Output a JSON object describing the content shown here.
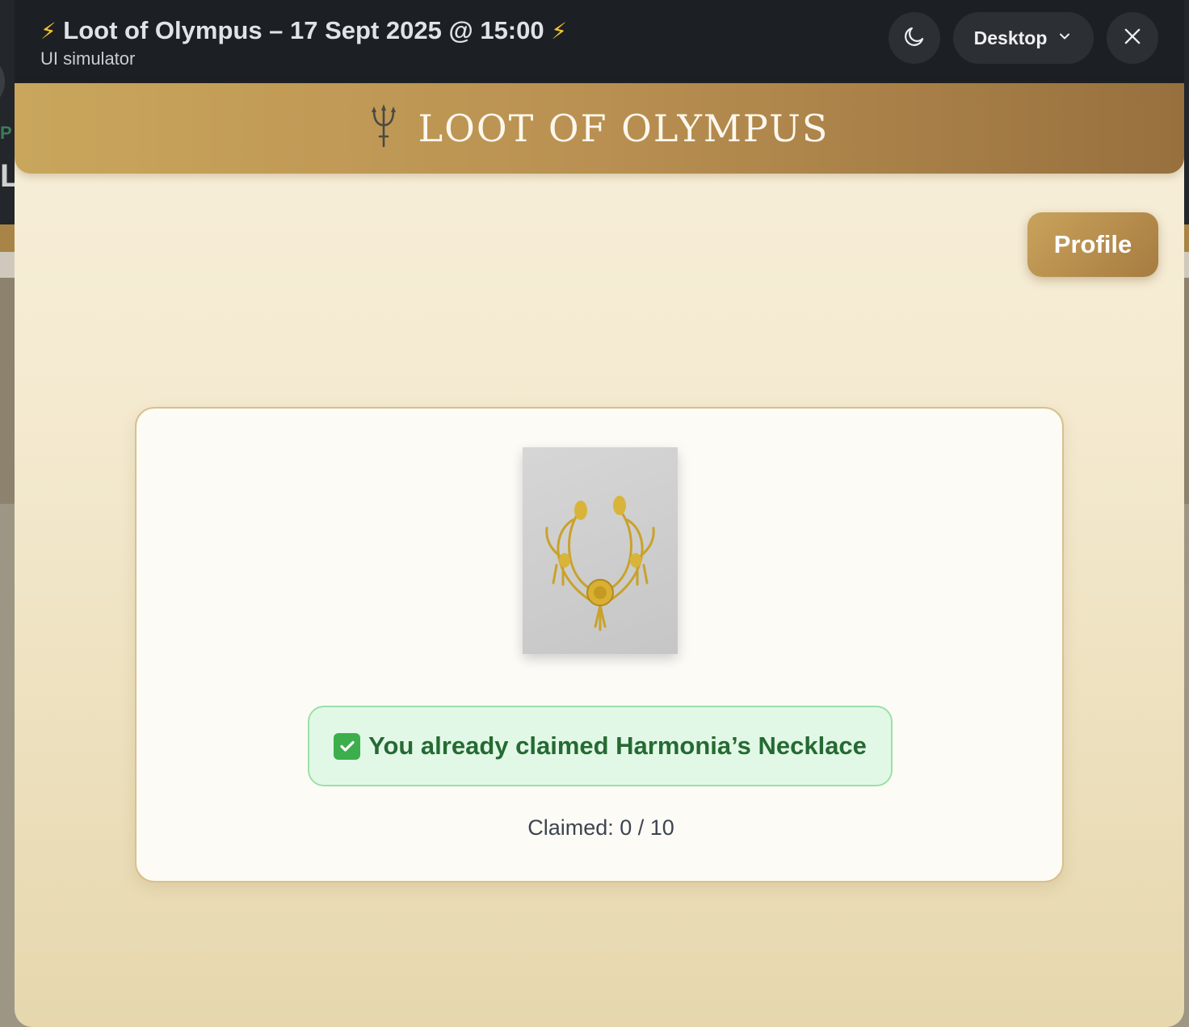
{
  "simulator": {
    "title": "Loot of Olympus – 17 Sept 2025 @ 15:00",
    "bolt": "⚡",
    "subtitle": "UI simulator",
    "device_label": "Desktop",
    "theme_icon": "moon-icon",
    "dropdown_icon": "chevron-down-icon",
    "close_icon": "close-icon"
  },
  "background_app": {
    "partial_letter_1": "P",
    "partial_letter_2": "L"
  },
  "header": {
    "logo_icon": "trident-icon",
    "brand": "LOOT OF OLYMPUS"
  },
  "profile_button": {
    "label": "Profile"
  },
  "item": {
    "image": "necklace-image",
    "claimed_message": "You already claimed Harmonia’s Necklace",
    "check_icon": "check-icon",
    "claimed_count_text": "Claimed: 0 / 10"
  },
  "colors": {
    "topbar": "#1c1f23",
    "gold": "#b99051",
    "success_bg": "#e2f8e6",
    "success_text": "#256a33"
  }
}
